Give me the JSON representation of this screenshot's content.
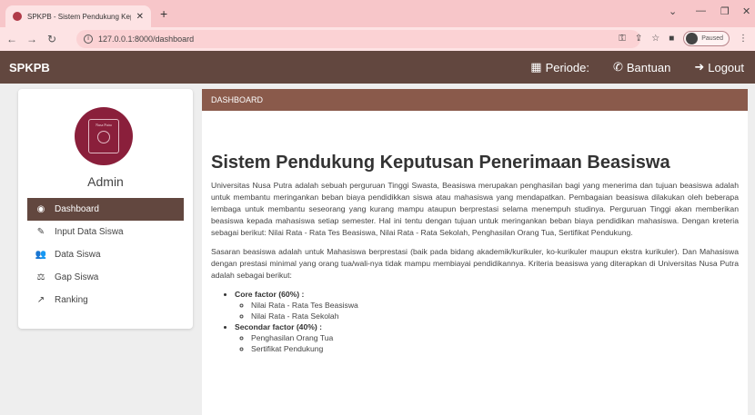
{
  "browser": {
    "tab_title": "SPKPB - Sistem Pendukung Kepu",
    "url": "127.0.0.1:8000/dashboard",
    "profile_status": "Paused"
  },
  "navbar": {
    "brand": "SPKPB",
    "periode_label": "Periode:",
    "bantuan_label": "Bantuan",
    "logout_label": "Logout"
  },
  "sidebar": {
    "logo_text": "Nusa Putra",
    "username": "Admin",
    "items": [
      {
        "label": "Dashboard",
        "icon": "dashboard-icon"
      },
      {
        "label": "Input Data Siswa",
        "icon": "edit-icon"
      },
      {
        "label": "Data Siswa",
        "icon": "users-icon"
      },
      {
        "label": "Gap Siswa",
        "icon": "scale-icon"
      },
      {
        "label": "Ranking",
        "icon": "chart-line-icon"
      }
    ]
  },
  "breadcrumb": "DASHBOARD",
  "main": {
    "title": "Sistem Pendukung Keputusan Penerimaan Beasiswa",
    "paragraph1": "Universitas Nusa Putra adalah sebuah perguruan Tinggi Swasta, Beasiswa merupakan penghasilan bagi yang menerima dan tujuan beasiswa adalah untuk membantu meringankan beban biaya pendidikkan siswa atau mahasiswa yang mendapatkan. Pembagaian beasiswa dilakukan oleh beberapa lembaga untuk membantu seseorang yang kurang mampu ataupun berprestasi selama menempuh studinya. Perguruan Tinggi akan memberikan beasiswa kepada mahasiswa setiap semester. Hal ini tentu dengan tujuan untuk meringankan beban biaya pendidikan mahasiswa. Dengan kreteria sebagai berikut: Nilai Rata - Rata Tes Beasiswa, Nilai Rata - Rata Sekolah, Penghasilan Orang Tua, Sertifikat Pendukung.",
    "paragraph2": "Sasaran beasiswa adalah untuk Mahasiswa berprestasi (baik pada bidang akademik/kurikuler, ko-kurikuler maupun ekstra kurikuler). Dan Mahasiswa dengan prestasi minimal yang orang tua/wali-nya tidak mampu membiayai pendidikannya. Kriteria beasiswa yang diterapkan di Universitas Nusa Putra adalah sebagai berikut:",
    "core_factor": "Core factor (60%) :",
    "core_items": [
      "Nilai Rata - Rata Tes Beasiswa",
      "Nilai Rata - Rata Sekolah"
    ],
    "secondary_factor": "Secondar factor (40%) :",
    "secondary_items": [
      "Penghasilan Orang Tua",
      "Sertifikat Pendukung"
    ]
  },
  "colors": {
    "navbar": "#62473f",
    "breadcrumb": "#8a5a4b",
    "logo": "#8a1f3b"
  }
}
